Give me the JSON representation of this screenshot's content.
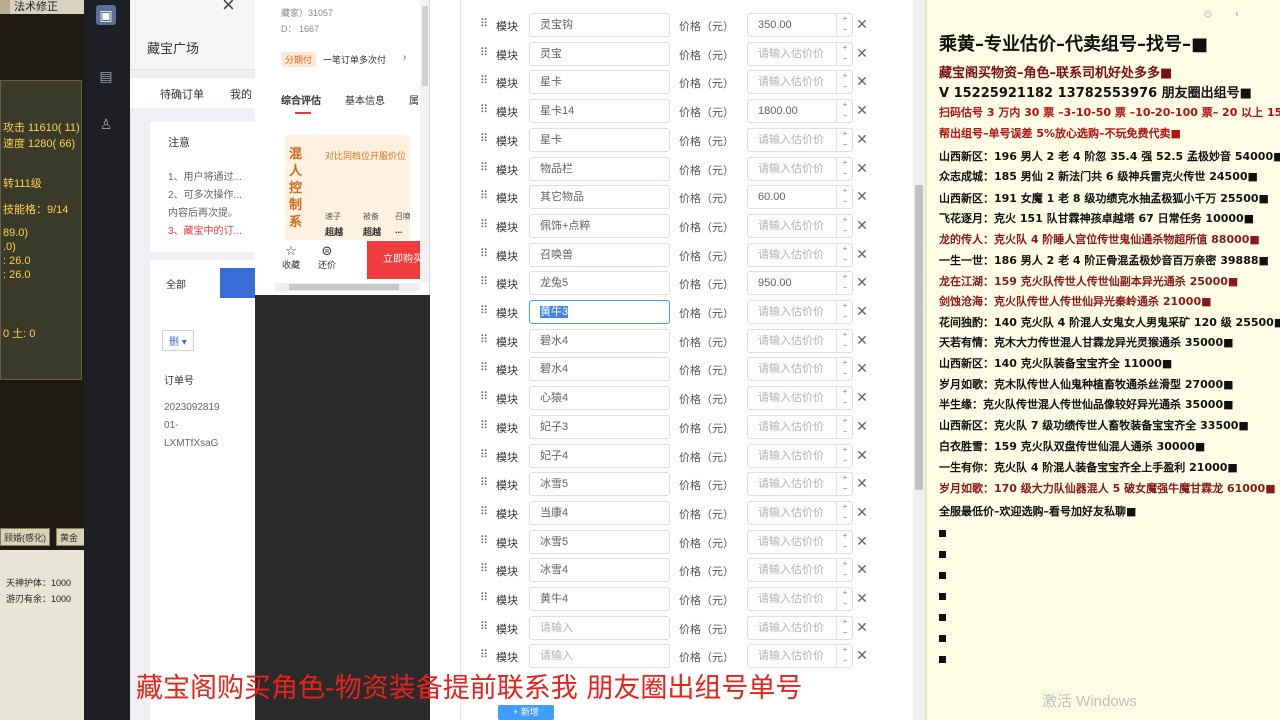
{
  "game": {
    "top_label": "法术修正",
    "stats": [
      "攻击 11610( 11)",
      "速度 1280( 66)",
      "转111级",
      "技能格：9/14",
      "89.0)",
      ".0)",
      ": 26.0",
      ": 26.0",
      "0 土: 0"
    ],
    "tabs": [
      "顾婚(感化)",
      "黄金"
    ],
    "info": [
      "天神护体：1000",
      "游刃有余：1000"
    ]
  },
  "bg_page": {
    "title": "藏宝广场",
    "tabs": [
      "待确订单",
      "我的"
    ],
    "notice_title": "注意",
    "notice_lines": [
      "1、用户将通过...",
      "2、可多次操作...",
      "内容后再次提。",
      "3、藏宝中的订..."
    ],
    "filter_label": "全部",
    "dropdown_label": "删",
    "order_header": "订单号",
    "order_lines": [
      "2023092819",
      "01-",
      "LXMTfXsaG"
    ]
  },
  "mobile": {
    "stat1": "藏家）31057",
    "stat2": "D：  1667",
    "promo_tag": "分期付",
    "promo_text": "一笔订单多次付",
    "tabs": [
      "综合评估",
      "基本信息",
      "属"
    ],
    "card_big": "混人控制系",
    "card_head": "对比同档位开服价位",
    "card_cells": [
      "速子",
      "被备",
      "召唤兽"
    ],
    "card_vals": [
      "超越",
      "超越",
      "..."
    ],
    "bottom": [
      "收藏",
      "还价"
    ],
    "buy": "立即购买"
  },
  "editor": {
    "rows": [
      {
        "label": "模块",
        "name": "灵宝钩",
        "price": "350.00"
      },
      {
        "label": "模块",
        "name": "灵宝",
        "price": ""
      },
      {
        "label": "模块",
        "name": "星卡",
        "price": ""
      },
      {
        "label": "模块",
        "name": "星卡14",
        "price": "1800.00"
      },
      {
        "label": "模块",
        "name": "星卡",
        "price": ""
      },
      {
        "label": "模块",
        "name": "物品栏",
        "price": ""
      },
      {
        "label": "模块",
        "name": "其它物品",
        "price": "60.00"
      },
      {
        "label": "模块",
        "name": "佩饰+点粹",
        "price": ""
      },
      {
        "label": "模块",
        "name": "召唤兽",
        "price": ""
      },
      {
        "label": "模块",
        "name": "龙兔5",
        "price": "950.00"
      },
      {
        "label": "模块",
        "name": "黄牛3",
        "price": "",
        "selected": true
      },
      {
        "label": "模块",
        "name": "碧水4",
        "price": ""
      },
      {
        "label": "模块",
        "name": "碧水4",
        "price": ""
      },
      {
        "label": "模块",
        "name": "心猿4",
        "price": ""
      },
      {
        "label": "模块",
        "name": "妃子3",
        "price": ""
      },
      {
        "label": "模块",
        "name": "妃子4",
        "price": ""
      },
      {
        "label": "模块",
        "name": "冰雪5",
        "price": ""
      },
      {
        "label": "模块",
        "name": "当康4",
        "price": ""
      },
      {
        "label": "模块",
        "name": "冰雪5",
        "price": ""
      },
      {
        "label": "模块",
        "name": "冰雪4",
        "price": ""
      },
      {
        "label": "模块",
        "name": "黄牛4",
        "price": ""
      },
      {
        "label": "模块",
        "name": "",
        "price": ""
      },
      {
        "label": "模块",
        "name": "",
        "price": ""
      }
    ],
    "price_label": "价格（元）",
    "name_placeholder": "请输入",
    "price_placeholder": "请输入估价价",
    "add_label": "+ 新增"
  },
  "notes": {
    "title": "乘黄–专业估价–代卖组号–找号–■",
    "lines": [
      {
        "text": "藏宝阁买物资–角色–联系司机好处多多■",
        "color": "#7a1010",
        "size": "lg"
      },
      {
        "text": "V 15225921182   13782553976 朋友圈出组号■",
        "color": "#111111",
        "size": "lg"
      },
      {
        "text": "扫码估号 3 万内 30 票 –3-10-50 票  –10-20-100 票– 20 以上 150■",
        "color": "#b31010",
        "size": ""
      },
      {
        "text": "帮出组号–单号误差 5%放心选购–不玩免费代卖■",
        "color": "#b31010",
        "size": ""
      },
      {
        "text": "山西新区：196 男人 2 老 4 阶忽 35.4 强 52.5 孟极妙音 54000■",
        "color": "#111111",
        "size": ""
      },
      {
        "text": "众志成城：185 男仙 2 新法门共 6 级神兵雷克火传世 24500■",
        "color": "#111111",
        "size": ""
      },
      {
        "text": "山西新区：191 女魔 1 老 8 级功绩克水抽孟极狐小千万 25500■",
        "color": "#111111",
        "size": ""
      },
      {
        "text": "飞花逐月：克火 151 队甘霖神孩卓越塔 67 日常任务 10000■",
        "color": "#111111",
        "size": ""
      },
      {
        "text": "龙的传人：克火队 4 阶睡人宫位传世鬼仙通杀物超所值 88000■",
        "color": "#8a1a1a",
        "size": ""
      },
      {
        "text": "一生一世：186 男人 2 老 4 阶正骨混孟极妙音百万亲密 39888■",
        "color": "#111111",
        "size": ""
      },
      {
        "text": "龙在江湖：159 克火队传世人传世仙副本异光通杀 25000■",
        "color": "#8a1a1a",
        "size": ""
      },
      {
        "text": "剑蚀沧海：克火队传世人传世仙异光秦岭通杀 21000■",
        "color": "#8a1a1a",
        "size": ""
      },
      {
        "text": "花间独酌：140 克火队 4 阶混人女鬼女人男鬼采矿 120 级 25500■",
        "color": "#111111",
        "size": ""
      },
      {
        "text": "天若有情：克木大力传世混人甘霖龙异光灵猴通杀 35000■",
        "color": "#111111",
        "size": ""
      },
      {
        "text": "山西新区：140 克火队装备宝宝齐全 11000■",
        "color": "#111111",
        "size": ""
      },
      {
        "text": "岁月如歌：克木队传世人仙鬼种植畜牧通杀丝滑型 27000■",
        "color": "#111111",
        "size": ""
      },
      {
        "text": "半生缘：克火队传世混人传世仙品像较好异光通杀 35000■",
        "color": "#111111",
        "size": ""
      },
      {
        "text": "山西新区：克火队 7 级功绩传世人畜牧装备宝宝齐全 33500■",
        "color": "#111111",
        "size": ""
      },
      {
        "text": "白衣胜雪：159 克火队双盘传世仙混人通杀 30000■",
        "color": "#111111",
        "size": ""
      },
      {
        "text": "一生有你：克火队 4 阶混人装备宝宝齐全上手盈利 21000■",
        "color": "#111111",
        "size": ""
      },
      {
        "text": "岁月如歌：170 级大力队仙器混人 5 破女魔强牛魔甘霖龙 61000■",
        "color": "#8a1a1a",
        "size": ""
      },
      {
        "text": "全服最低价–欢迎选购–看号加好友私聊■",
        "color": "#111111",
        "size": ""
      }
    ],
    "bullets": 7,
    "watermark": "激活 Windows"
  },
  "caption": "藏宝阁购买角色-物资装备提前联系我      朋友圈出组号单号"
}
